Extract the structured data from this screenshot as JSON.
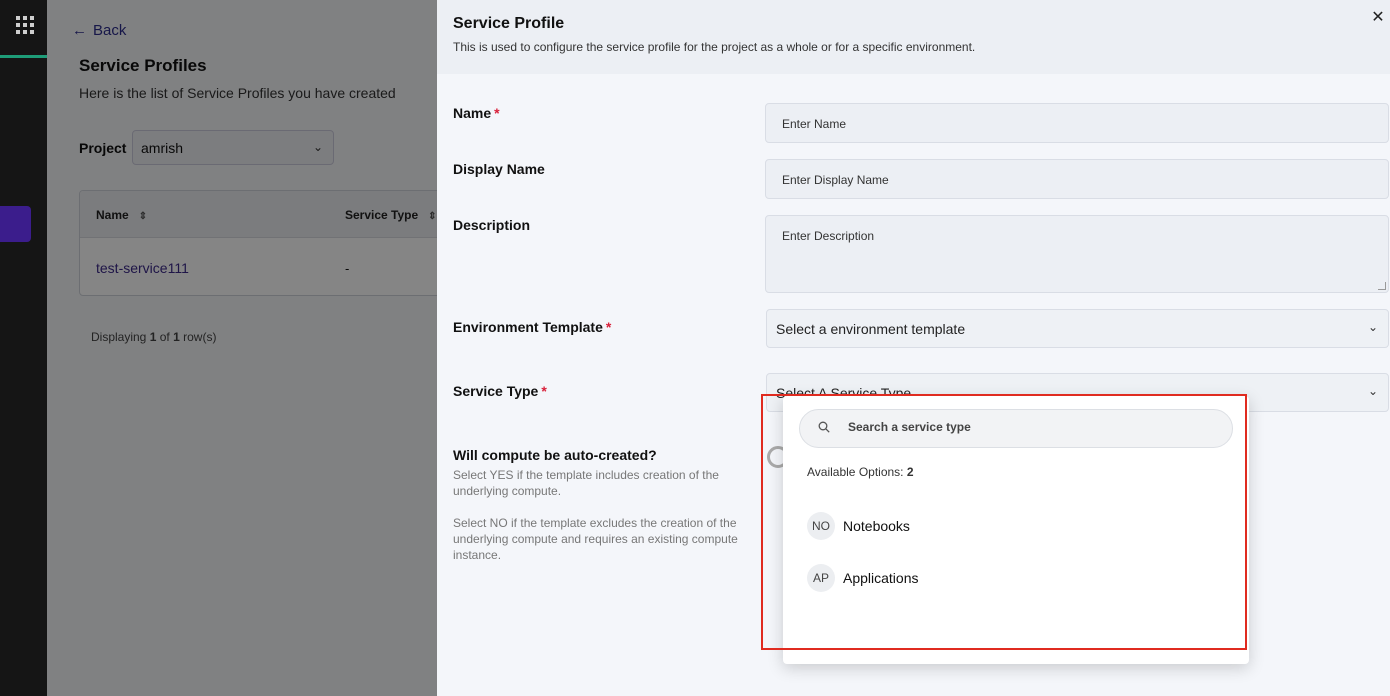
{
  "background_page": {
    "back_label": "Back",
    "title": "Service Profiles",
    "subtitle": "Here is the list of Service Profiles you have created",
    "project_label": "Project",
    "project_value": "amrish",
    "table": {
      "columns": [
        "Name",
        "Service Type"
      ],
      "rows": [
        [
          "test-service111",
          "-"
        ]
      ]
    },
    "count_prefix": "Displaying",
    "count_shown": "1",
    "count_of": "of",
    "count_total": "1",
    "count_suffix": "row(s)"
  },
  "drawer": {
    "title": "Service Profile",
    "subtitle": "This is used to configure the service profile for the project as a whole or for a specific environment.",
    "fields": {
      "name": {
        "label": "Name",
        "placeholder": "Enter Name"
      },
      "display_name": {
        "label": "Display Name",
        "placeholder": "Enter Display Name"
      },
      "description": {
        "label": "Description",
        "placeholder": "Enter Description"
      },
      "environment_template": {
        "label": "Environment Template",
        "value": "Select a environment template"
      },
      "service_type": {
        "label": "Service Type",
        "value": "Select A Service Type"
      }
    },
    "compute": {
      "question": "Will compute be auto-created?",
      "help_yes": "Select YES if the template includes creation of the underlying compute.",
      "help_no": "Select NO if the template excludes the creation of the underlying compute and requires an existing compute instance."
    },
    "required_mark": "*"
  },
  "dropdown": {
    "search_placeholder": "Search a service type",
    "available_label": "Available Options:",
    "available_count": "2",
    "options": [
      {
        "abbr": "NO",
        "label": "Notebooks"
      },
      {
        "abbr": "AP",
        "label": "Applications"
      }
    ]
  },
  "colors": {
    "highlight": "#e02b20",
    "required": "#d8203a",
    "link": "#3c2a8a",
    "rail": "#151515",
    "rail_accent": "#1e9c78"
  }
}
